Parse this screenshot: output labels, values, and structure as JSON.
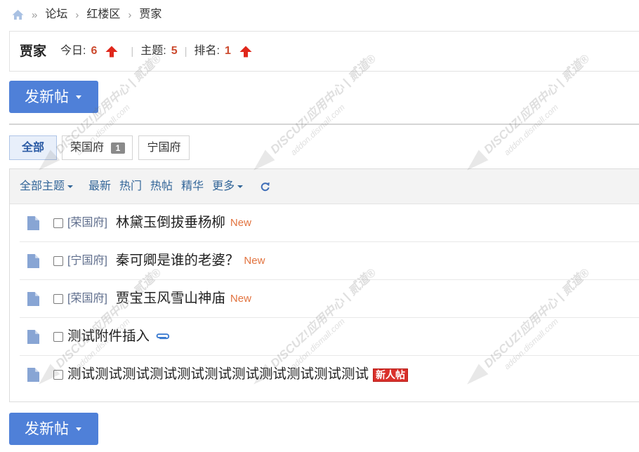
{
  "breadcrumb": {
    "home_icon": "home-icon",
    "home_separator": "»",
    "separator": "›",
    "items": [
      "论坛",
      "红楼区",
      "贾家"
    ]
  },
  "forum": {
    "name": "贾家",
    "today_label": "今日:",
    "today_value": "6",
    "threads_label": "主题:",
    "threads_value": "5",
    "rank_label": "排名:",
    "rank_value": "1",
    "divider": "|",
    "trend_icon": "arrow-up-icon"
  },
  "new_post_button": {
    "label": "发新帖",
    "caret_icon": "caret-down-icon"
  },
  "subforum_tabs": [
    {
      "label": "全部",
      "active": true
    },
    {
      "label": "荣国府",
      "count": "1",
      "active": false
    },
    {
      "label": "宁国府",
      "active": false
    }
  ],
  "filter_bar": {
    "all_threads": "全部主题",
    "latest": "最新",
    "hot": "热门",
    "hot_posts": "热帖",
    "digest": "精华",
    "more": "更多",
    "refresh_icon": "refresh-icon"
  },
  "threads": [
    {
      "icon": "document-icon",
      "category": "[荣国府]",
      "title": "林黛玉倒拔垂杨柳",
      "tag": "New"
    },
    {
      "icon": "document-icon",
      "category": "[宁国府]",
      "title": "秦可卿是谁的老婆？",
      "tag": "New"
    },
    {
      "icon": "document-icon",
      "category": "[荣国府]",
      "title": "贾宝玉风雪山神庙",
      "tag": "New"
    },
    {
      "icon": "document-icon",
      "title": "测试附件插入",
      "attachment_icon": "paperclip-icon"
    },
    {
      "icon": "document-icon",
      "title": "测试测试测试测试测试测试测试测试测试测试测试",
      "badge": "新人帖"
    }
  ],
  "colors": {
    "accent": "#4f80d8",
    "link": "#336699",
    "text": "#333333",
    "stat": "#cc4a2e",
    "arrow": "#e0271b",
    "new_tag": "#e2733f",
    "badge": "#d9302b",
    "icon": "#88a5d4",
    "tab_active_bg": "#e8effa",
    "tab_active_text": "#2a5aa4"
  },
  "watermark": {
    "line1": "DISCUZ!应用中心 | 贰道®",
    "line2": "addon.dismall.com"
  }
}
